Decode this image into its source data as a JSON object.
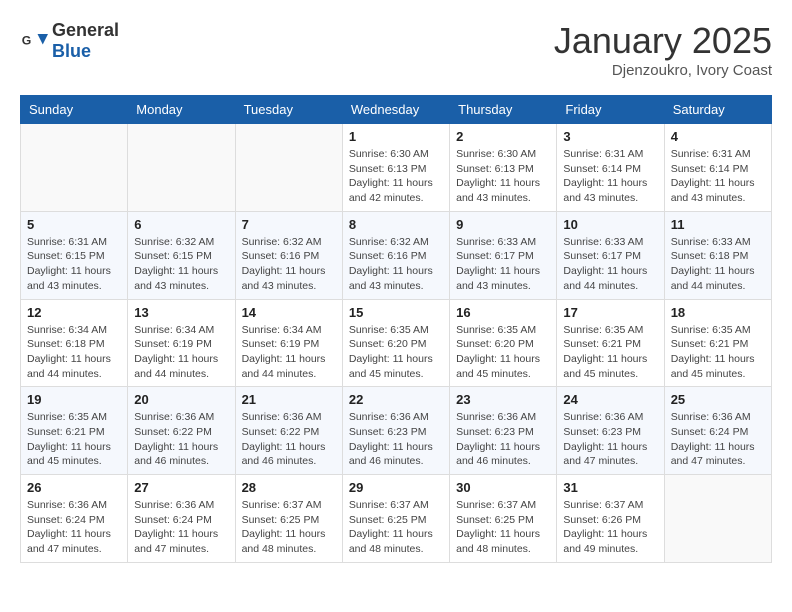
{
  "header": {
    "logo": {
      "general": "General",
      "blue": "Blue"
    },
    "title": "January 2025",
    "location": "Djenzoukro, Ivory Coast"
  },
  "days_of_week": [
    "Sunday",
    "Monday",
    "Tuesday",
    "Wednesday",
    "Thursday",
    "Friday",
    "Saturday"
  ],
  "weeks": [
    {
      "days": [
        {
          "num": "",
          "info": ""
        },
        {
          "num": "",
          "info": ""
        },
        {
          "num": "",
          "info": ""
        },
        {
          "num": "1",
          "info": "Sunrise: 6:30 AM\nSunset: 6:13 PM\nDaylight: 11 hours\nand 42 minutes."
        },
        {
          "num": "2",
          "info": "Sunrise: 6:30 AM\nSunset: 6:13 PM\nDaylight: 11 hours\nand 43 minutes."
        },
        {
          "num": "3",
          "info": "Sunrise: 6:31 AM\nSunset: 6:14 PM\nDaylight: 11 hours\nand 43 minutes."
        },
        {
          "num": "4",
          "info": "Sunrise: 6:31 AM\nSunset: 6:14 PM\nDaylight: 11 hours\nand 43 minutes."
        }
      ]
    },
    {
      "days": [
        {
          "num": "5",
          "info": "Sunrise: 6:31 AM\nSunset: 6:15 PM\nDaylight: 11 hours\nand 43 minutes."
        },
        {
          "num": "6",
          "info": "Sunrise: 6:32 AM\nSunset: 6:15 PM\nDaylight: 11 hours\nand 43 minutes."
        },
        {
          "num": "7",
          "info": "Sunrise: 6:32 AM\nSunset: 6:16 PM\nDaylight: 11 hours\nand 43 minutes."
        },
        {
          "num": "8",
          "info": "Sunrise: 6:32 AM\nSunset: 6:16 PM\nDaylight: 11 hours\nand 43 minutes."
        },
        {
          "num": "9",
          "info": "Sunrise: 6:33 AM\nSunset: 6:17 PM\nDaylight: 11 hours\nand 43 minutes."
        },
        {
          "num": "10",
          "info": "Sunrise: 6:33 AM\nSunset: 6:17 PM\nDaylight: 11 hours\nand 44 minutes."
        },
        {
          "num": "11",
          "info": "Sunrise: 6:33 AM\nSunset: 6:18 PM\nDaylight: 11 hours\nand 44 minutes."
        }
      ]
    },
    {
      "days": [
        {
          "num": "12",
          "info": "Sunrise: 6:34 AM\nSunset: 6:18 PM\nDaylight: 11 hours\nand 44 minutes."
        },
        {
          "num": "13",
          "info": "Sunrise: 6:34 AM\nSunset: 6:19 PM\nDaylight: 11 hours\nand 44 minutes."
        },
        {
          "num": "14",
          "info": "Sunrise: 6:34 AM\nSunset: 6:19 PM\nDaylight: 11 hours\nand 44 minutes."
        },
        {
          "num": "15",
          "info": "Sunrise: 6:35 AM\nSunset: 6:20 PM\nDaylight: 11 hours\nand 45 minutes."
        },
        {
          "num": "16",
          "info": "Sunrise: 6:35 AM\nSunset: 6:20 PM\nDaylight: 11 hours\nand 45 minutes."
        },
        {
          "num": "17",
          "info": "Sunrise: 6:35 AM\nSunset: 6:21 PM\nDaylight: 11 hours\nand 45 minutes."
        },
        {
          "num": "18",
          "info": "Sunrise: 6:35 AM\nSunset: 6:21 PM\nDaylight: 11 hours\nand 45 minutes."
        }
      ]
    },
    {
      "days": [
        {
          "num": "19",
          "info": "Sunrise: 6:35 AM\nSunset: 6:21 PM\nDaylight: 11 hours\nand 45 minutes."
        },
        {
          "num": "20",
          "info": "Sunrise: 6:36 AM\nSunset: 6:22 PM\nDaylight: 11 hours\nand 46 minutes."
        },
        {
          "num": "21",
          "info": "Sunrise: 6:36 AM\nSunset: 6:22 PM\nDaylight: 11 hours\nand 46 minutes."
        },
        {
          "num": "22",
          "info": "Sunrise: 6:36 AM\nSunset: 6:23 PM\nDaylight: 11 hours\nand 46 minutes."
        },
        {
          "num": "23",
          "info": "Sunrise: 6:36 AM\nSunset: 6:23 PM\nDaylight: 11 hours\nand 46 minutes."
        },
        {
          "num": "24",
          "info": "Sunrise: 6:36 AM\nSunset: 6:23 PM\nDaylight: 11 hours\nand 47 minutes."
        },
        {
          "num": "25",
          "info": "Sunrise: 6:36 AM\nSunset: 6:24 PM\nDaylight: 11 hours\nand 47 minutes."
        }
      ]
    },
    {
      "days": [
        {
          "num": "26",
          "info": "Sunrise: 6:36 AM\nSunset: 6:24 PM\nDaylight: 11 hours\nand 47 minutes."
        },
        {
          "num": "27",
          "info": "Sunrise: 6:36 AM\nSunset: 6:24 PM\nDaylight: 11 hours\nand 47 minutes."
        },
        {
          "num": "28",
          "info": "Sunrise: 6:37 AM\nSunset: 6:25 PM\nDaylight: 11 hours\nand 48 minutes."
        },
        {
          "num": "29",
          "info": "Sunrise: 6:37 AM\nSunset: 6:25 PM\nDaylight: 11 hours\nand 48 minutes."
        },
        {
          "num": "30",
          "info": "Sunrise: 6:37 AM\nSunset: 6:25 PM\nDaylight: 11 hours\nand 48 minutes."
        },
        {
          "num": "31",
          "info": "Sunrise: 6:37 AM\nSunset: 6:26 PM\nDaylight: 11 hours\nand 49 minutes."
        },
        {
          "num": "",
          "info": ""
        }
      ]
    }
  ]
}
